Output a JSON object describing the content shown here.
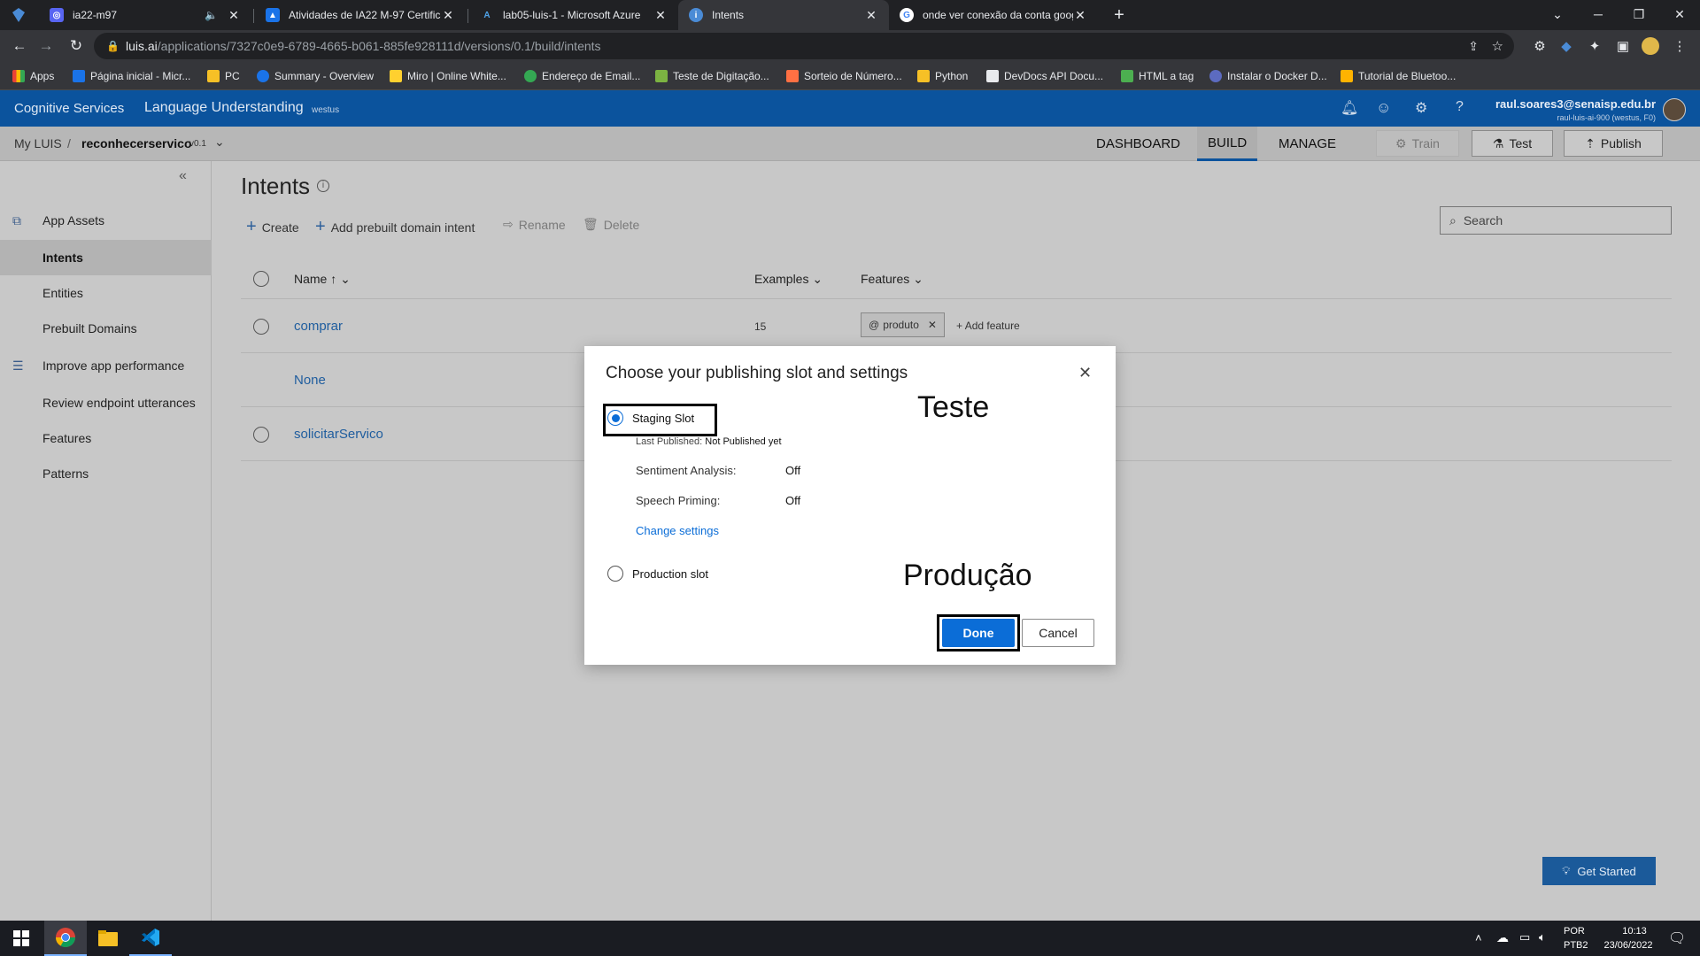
{
  "browser": {
    "tabs": [
      {
        "title": "ia22-m97",
        "favicon_color": "#5865f2",
        "icon": "discord-icon",
        "muted_icon": "speaker-muted-icon"
      },
      {
        "title": "Atividades de IA22 M-97 Certifica",
        "favicon_color": "#1a73e8",
        "icon": "classroom-icon"
      },
      {
        "title": "lab05-luis-1 - Microsoft Azure",
        "favicon_color": "#0078d4",
        "icon": "azure-icon"
      },
      {
        "title": "Intents",
        "favicon_color": "#4a8bd6",
        "icon": "luis-icon"
      },
      {
        "title": "onde ver conexão da conta goog",
        "favicon_color": "#ffffff",
        "icon": "google-icon"
      }
    ],
    "new_tab_label": "+",
    "url_host": "luis.ai",
    "url_path": "/applications/7327c0e9-6789-4665-b061-885fe928111d/versions/0.1/build/intents",
    "bookmarks": [
      {
        "label": "Apps",
        "color": "#ea4335"
      },
      {
        "label": "Página inicial - Micr...",
        "color": "#1a73e8"
      },
      {
        "label": "PC",
        "color": "#f6c026"
      },
      {
        "label": "Summary - Overview",
        "color": "#1a73e8"
      },
      {
        "label": "Miro | Online White...",
        "color": "#ffd02f"
      },
      {
        "label": "Endereço de Email...",
        "color": "#34a853"
      },
      {
        "label": "Teste de Digitação...",
        "color": "#7cb342"
      },
      {
        "label": "Sorteio de Número...",
        "color": "#ff7043"
      },
      {
        "label": "Python",
        "color": "#f6c026"
      },
      {
        "label": "DevDocs API Docu...",
        "color": "#e8eaed"
      },
      {
        "label": "HTML a tag",
        "color": "#4caf50"
      },
      {
        "label": "Instalar o Docker D...",
        "color": "#5c6bc0"
      },
      {
        "label": "Tutorial de Bluetoo...",
        "color": "#ffb300"
      }
    ]
  },
  "app": {
    "brand": "Cognitive Services",
    "product": "Language Understanding",
    "region": "westus",
    "user_email": "raul.soares3@senaisp.edu.br",
    "user_sub": "raul-luis-ai-900 (westus, F0)",
    "breadcrumb_root": "My LUIS",
    "breadcrumb_sep": "/",
    "app_name": "reconhecerservico",
    "version": "v0.1",
    "nav_tabs": [
      "DASHBOARD",
      "BUILD",
      "MANAGE"
    ],
    "train_label": "Train",
    "test_label": "Test",
    "publish_label": "Publish",
    "get_started_label": "Get Started",
    "accent": "#0b539d"
  },
  "sidebar": {
    "items": [
      {
        "label": "App Assets",
        "icon": "assets-icon"
      },
      {
        "label": "Intents"
      },
      {
        "label": "Entities"
      },
      {
        "label": "Prebuilt Domains"
      },
      {
        "label": "Improve app performance",
        "icon": "sliders-icon"
      },
      {
        "label": "Review endpoint utterances"
      },
      {
        "label": "Features"
      },
      {
        "label": "Patterns"
      }
    ]
  },
  "main": {
    "title": "Intents",
    "commands": {
      "create": "Create",
      "add_prebuilt": "Add prebuilt domain intent",
      "rename": "Rename",
      "delete": "Delete"
    },
    "search_placeholder": "Search",
    "columns": {
      "name": "Name",
      "examples": "Examples",
      "features": "Features"
    },
    "rows": [
      {
        "name": "comprar",
        "examples": "15",
        "feature": "produto",
        "add_feature": "Add feature"
      },
      {
        "name": "None",
        "examples": "",
        "feature": ""
      },
      {
        "name": "solicitarServico",
        "examples": "",
        "feature": ""
      }
    ]
  },
  "modal": {
    "title": "Choose your publishing slot and settings",
    "staging_label": "Staging Slot",
    "last_published_label": "Last Published:",
    "last_published_value": "Not Published yet",
    "sentiment_label": "Sentiment Analysis:",
    "sentiment_value": "Off",
    "speech_label": "Speech Priming:",
    "speech_value": "Off",
    "change_settings": "Change settings",
    "production_label": "Production slot",
    "annotation_staging": "Teste",
    "annotation_production": "Produção",
    "done_label": "Done",
    "cancel_label": "Cancel"
  },
  "taskbar": {
    "lang_top": "POR",
    "lang_bottom": "PTB2",
    "time": "10:13",
    "date": "23/06/2022"
  }
}
